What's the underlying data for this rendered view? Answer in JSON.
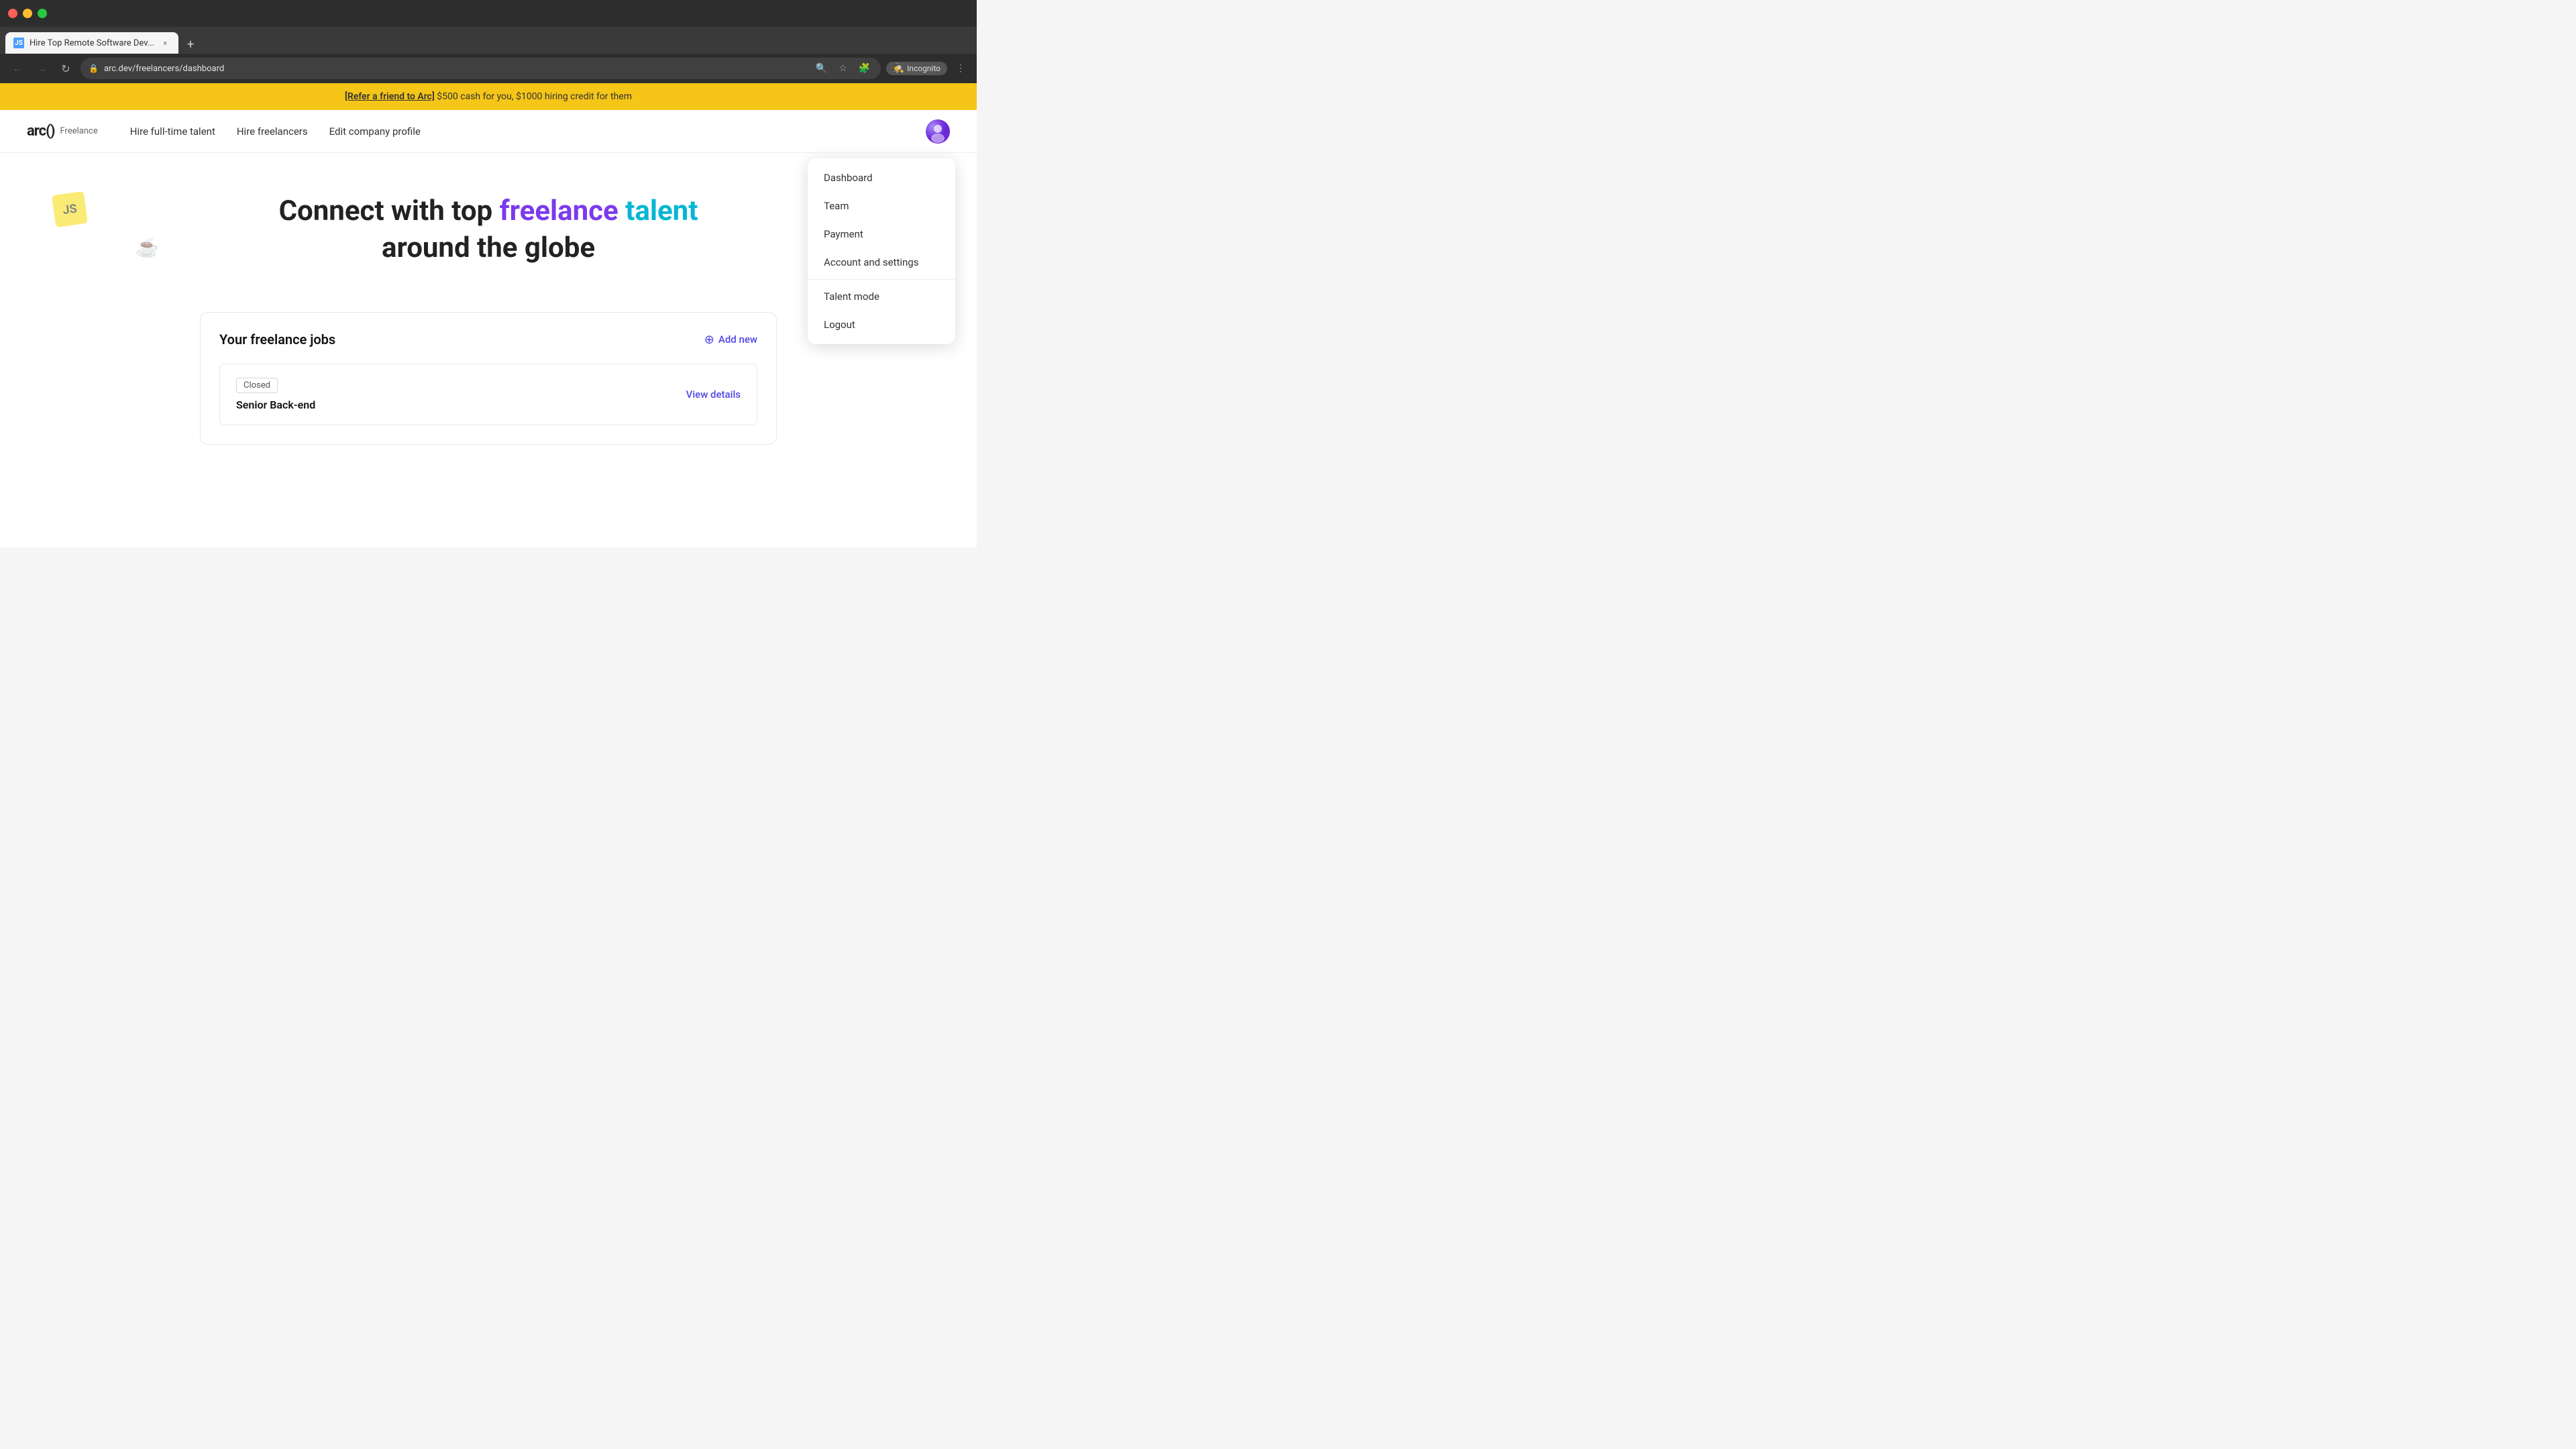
{
  "browser": {
    "tab_title": "Hire Top Remote Software Dev...",
    "tab_favicon": "JS",
    "url": "arc.dev/freelancers/dashboard",
    "new_tab_label": "+",
    "nav": {
      "back_icon": "←",
      "forward_icon": "→",
      "reload_icon": "↻"
    },
    "incognito_label": "Incognito"
  },
  "banner": {
    "link_text": "[Refer a friend to Arc]",
    "message": " $500 cash for you, $1000 hiring credit for them"
  },
  "nav": {
    "logo_text": "arc()",
    "logo_badge": "Freelance",
    "links": [
      {
        "id": "hire-fulltime",
        "label": "Hire full-time talent"
      },
      {
        "id": "hire-freelancers",
        "label": "Hire freelancers"
      },
      {
        "id": "edit-company",
        "label": "Edit company profile"
      }
    ]
  },
  "dropdown": {
    "items": [
      {
        "id": "dashboard",
        "label": "Dashboard"
      },
      {
        "id": "team",
        "label": "Team"
      },
      {
        "id": "payment",
        "label": "Payment"
      },
      {
        "id": "account-settings",
        "label": "Account and settings"
      },
      {
        "id": "talent-mode",
        "label": "Talent mode"
      },
      {
        "id": "logout",
        "label": "Logout"
      }
    ]
  },
  "hero": {
    "line1_prefix": "Connect with top ",
    "line1_word1": "freelance",
    "line1_word2": "talent",
    "line2": "around the globe"
  },
  "jobs": {
    "section_title": "Your freelance jobs",
    "add_new_label": "Add new",
    "items": [
      {
        "status": "Closed",
        "name": "Senior Back-end",
        "view_details_label": "View details"
      }
    ]
  }
}
